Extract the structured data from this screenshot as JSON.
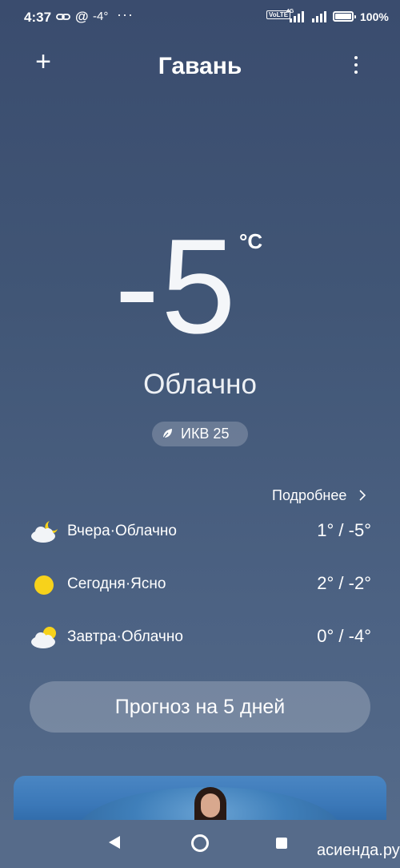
{
  "status_bar": {
    "time": "4:37",
    "link_icon": "link-icon",
    "at_symbol": "@",
    "temp": "-4°",
    "more": "···",
    "volte": "VoLTE",
    "network": "4G",
    "battery_percent": "100%",
    "battery_level": 1.0
  },
  "header": {
    "add_icon": "plus-icon",
    "add_symbol": "+",
    "city": "Гавань",
    "menu_icon": "more-vertical-icon"
  },
  "current": {
    "temperature": "-5",
    "unit": "°C",
    "condition": "Облачно",
    "aqi_icon": "leaf-icon",
    "aqi": "ИКВ 25"
  },
  "summary": {
    "details_label": "Подробнее",
    "details_icon": "chevron-right-icon",
    "days": [
      {
        "label": "Вчера·Облачно",
        "temps": "1° / -5°",
        "icon": "partly-cloudy-night-icon"
      },
      {
        "label": "Сегодня·Ясно",
        "temps": "2° / -2°",
        "icon": "sun-icon"
      },
      {
        "label": "Завтра·Облачно",
        "temps": "0° / -4°",
        "icon": "partly-cloudy-icon"
      }
    ]
  },
  "forecast_button": "Прогноз на 5 дней",
  "watermark": "асиенда.ру",
  "colors": {
    "background_top": "#3a4c6e",
    "background_bottom": "#566c8b",
    "sun": "#f7d21b",
    "cloud": "#f2f4f7"
  }
}
